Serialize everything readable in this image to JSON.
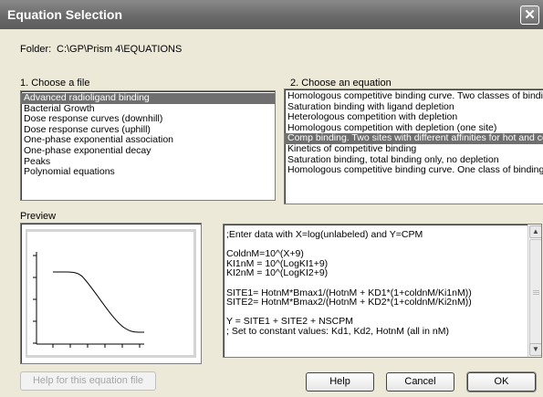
{
  "window": {
    "title": "Equation Selection",
    "close_glyph": "✕"
  },
  "folder": {
    "label": "Folder:",
    "path": "C:\\GP\\Prism 4\\EQUATIONS"
  },
  "file_list": {
    "label": "1. Choose a file",
    "selected_index": 0,
    "items": [
      "Advanced radioligand binding",
      "Bacterial Growth",
      "Dose response curves (downhill)",
      "Dose response curves (uphill)",
      "One-phase exponential association",
      "One-phase exponential decay",
      "Peaks",
      "Polynomial equations"
    ]
  },
  "equation_list": {
    "label": "2. Choose an equation",
    "selected_index": 4,
    "items": [
      "Homologous competitive binding curve. Two classes of bindin",
      "Saturation binding with ligand depletion",
      "Heterologous competition with depletion",
      "Homologous competition with depletion (one site)",
      "Comp binding. Two sites with different affinities for hot and col",
      "Kinetics of competitive binding",
      "Saturation binding, total binding only, no depletion",
      "Homologous competitive binding curve. One class of binding s"
    ]
  },
  "preview": {
    "label": "Preview"
  },
  "equation_text": ";Enter data with X=log(unlabeled) and Y=CPM\n\nColdnM=10^(X+9)\nKI1nM = 10^(LogKI1+9)\nKI2nM = 10^(LogKI2+9)\n\nSITE1= HotnM*Bmax1/(HotnM + KD1*(1+coldnM/Ki1nM))\nSITE2= HotnM*Bmax2/(HotnM + KD2*(1+coldnM/Ki2nM))\n\nY = SITE1 + SITE2 + NSCPM\n; Set to constant values: Kd1, Kd2, HotnM (all in nM)",
  "buttons": {
    "help_file": "Help for this equation file",
    "help": "Help",
    "cancel": "Cancel",
    "ok": "OK"
  },
  "icons": {
    "scroll_up": "▲",
    "scroll_down": "▼"
  },
  "colors": {
    "selection": "#6f6f6f",
    "titlebar": "#6a6a6a",
    "dialog_bg": "#ece9d8"
  }
}
